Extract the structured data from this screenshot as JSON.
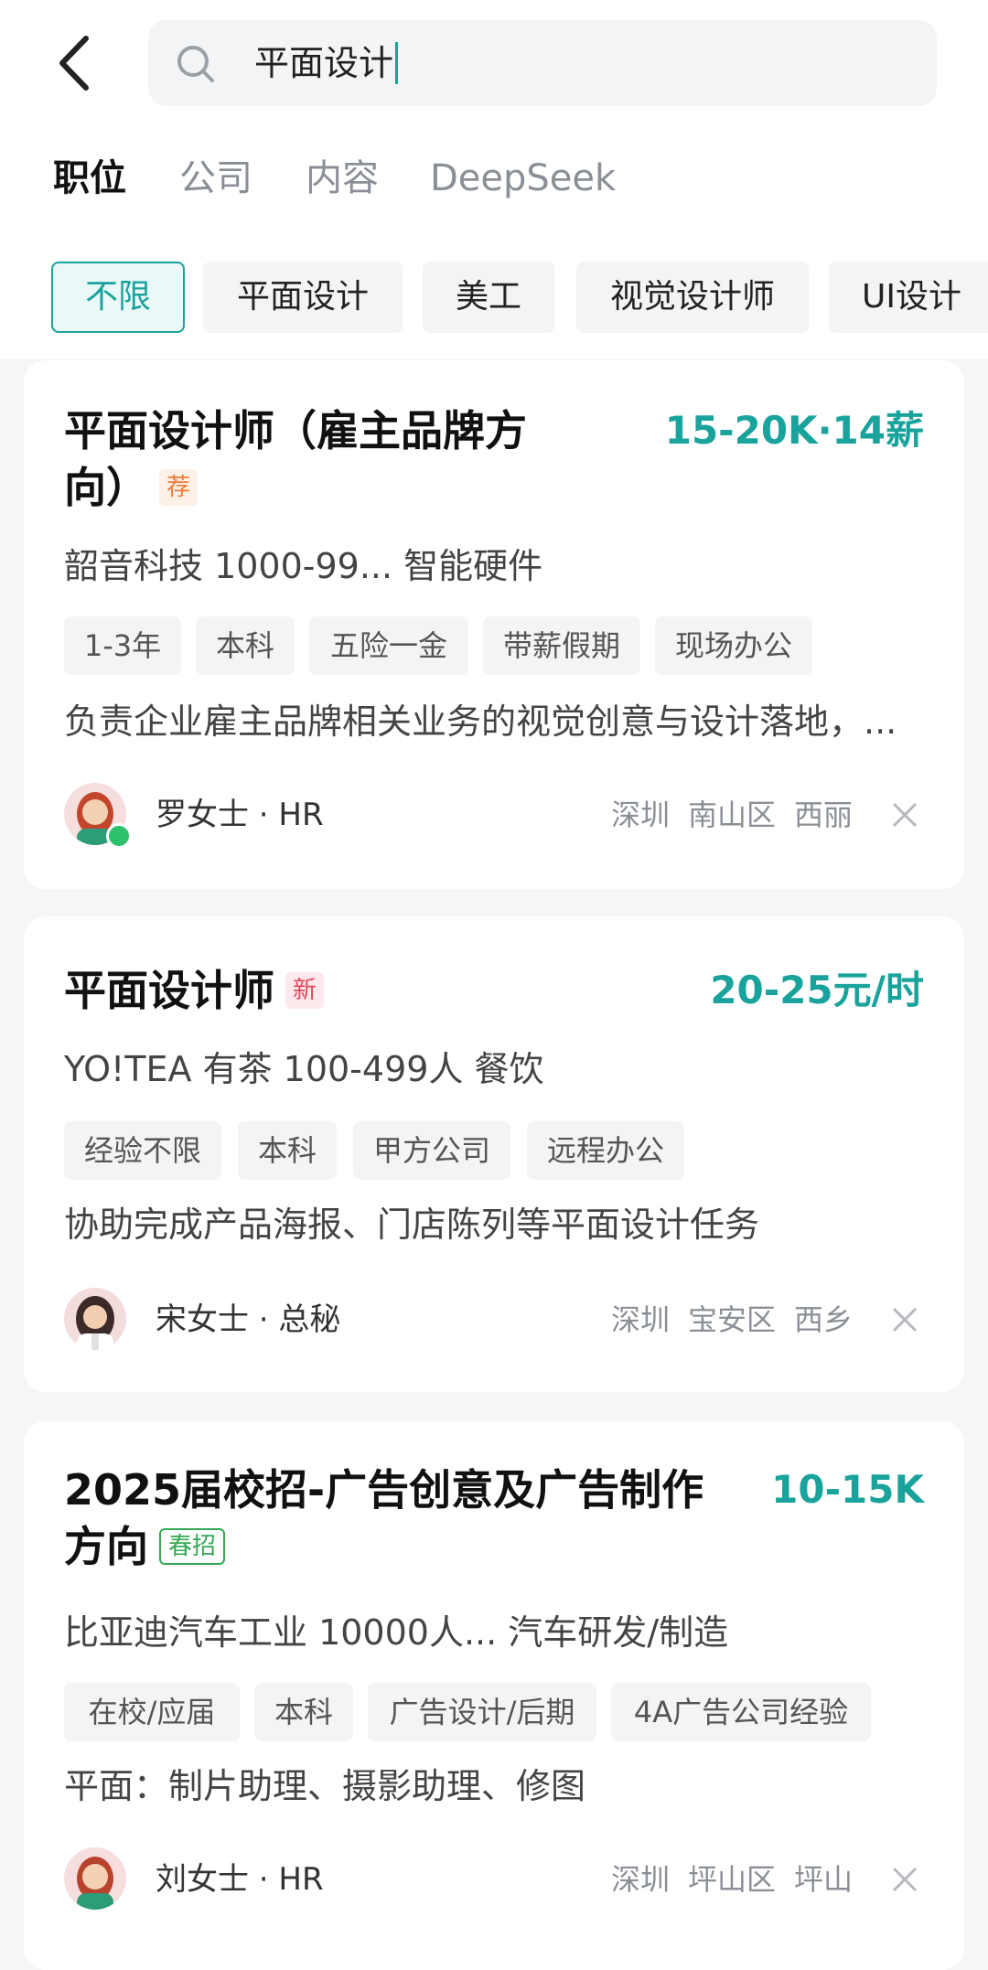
{
  "search": {
    "query": "平面设计"
  },
  "tabs": [
    {
      "label": "职位",
      "active": true
    },
    {
      "label": "公司",
      "active": false
    },
    {
      "label": "内容",
      "active": false
    },
    {
      "label": "DeepSeek",
      "active": false
    }
  ],
  "filters": [
    {
      "label": "不限",
      "selected": true
    },
    {
      "label": "平面设计",
      "selected": false
    },
    {
      "label": "美工",
      "selected": false
    },
    {
      "label": "视觉设计师",
      "selected": false
    },
    {
      "label": "UI设计",
      "selected": false
    }
  ],
  "jobs": [
    {
      "title_line1": "平面设计师（雇主品牌方",
      "title_line2": "向）",
      "badge": "荐",
      "salary": "15-20K·14薪",
      "company": "韶音科技  1000-99...  智能硬件",
      "tags": [
        "1-3年",
        "本科",
        "五险一金",
        "带薪假期",
        "现场办公"
      ],
      "description": "负责企业雇主品牌相关业务的视觉创意与设计落地，...",
      "recruiter": "罗女士 · HR",
      "location": [
        "深圳",
        "南山区",
        "西丽"
      ]
    },
    {
      "title_line1": "平面设计师",
      "badge": "新",
      "salary": "20-25元/时",
      "company": "YO!TEA 有茶  100-499人  餐饮",
      "tags": [
        "经验不限",
        "本科",
        "甲方公司",
        "远程办公"
      ],
      "description": "协助完成产品海报、门店陈列等平面设计任务",
      "recruiter": "宋女士 · 总秘",
      "location": [
        "深圳",
        "宝安区",
        "西乡"
      ]
    },
    {
      "title_line1": "2025届校招-广告创意及广告制作",
      "title_line2": "方向",
      "badge": "春招",
      "salary": "10-15K",
      "company": "比亚迪汽车工业  10000人...  汽车研发/制造",
      "tags": [
        "在校/应届",
        "本科",
        "广告设计/后期",
        "4A广告公司经验"
      ],
      "description": "平面：制片助理、摄影助理、修图",
      "recruiter": "刘女士 · HR",
      "location": [
        "深圳",
        "坪山区",
        "坪山"
      ]
    }
  ],
  "colors": {
    "accent": "#1aa39c",
    "online": "#2bc26b",
    "badge_rec": "#f07a3a",
    "badge_new": "#e0475a",
    "badge_spring": "#34a853"
  }
}
